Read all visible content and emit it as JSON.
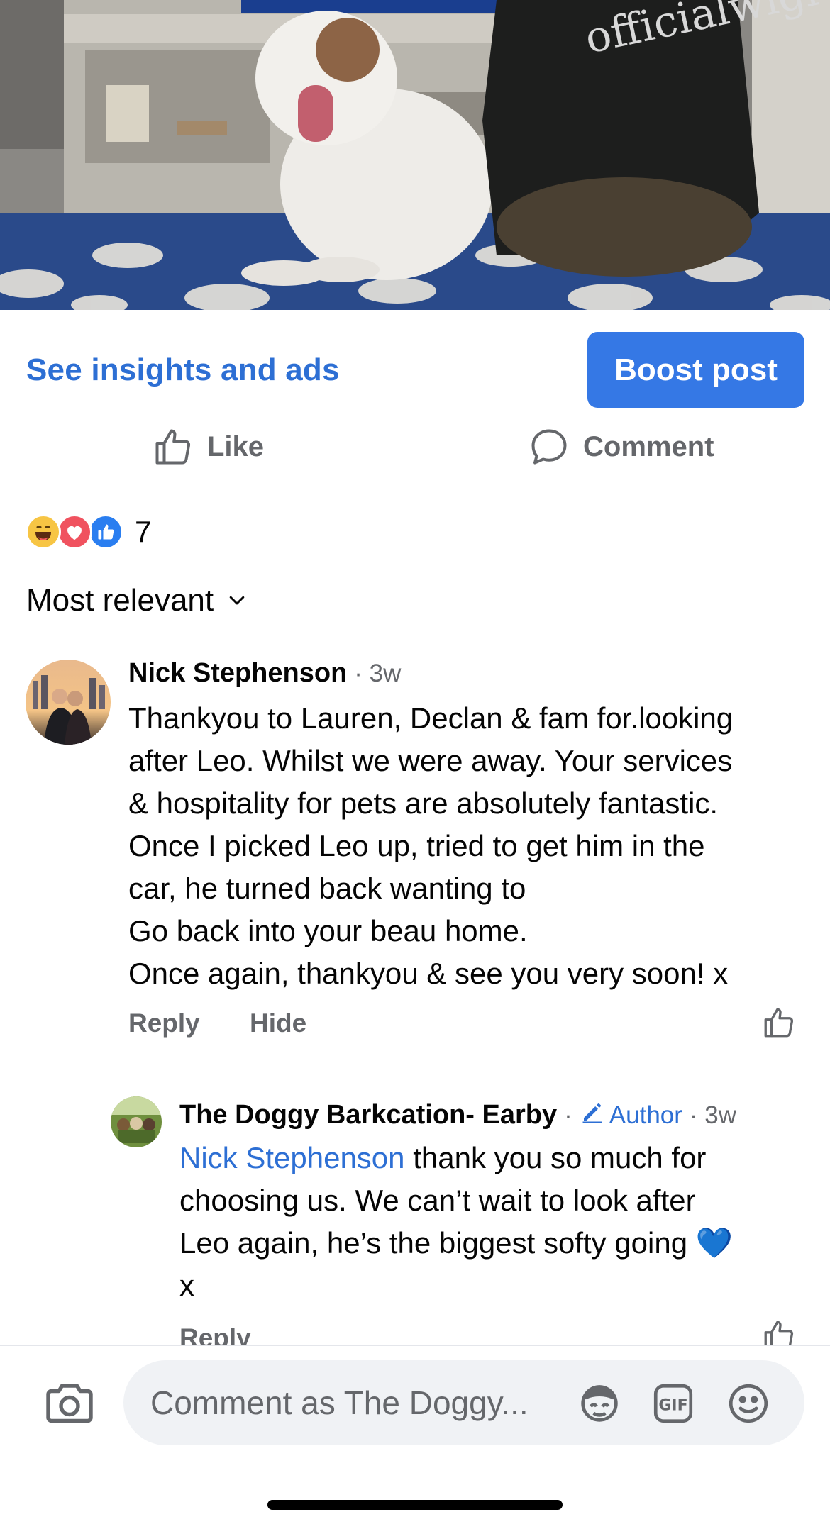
{
  "post": {
    "insights_link": "See insights and ads",
    "boost_button": "Boost post",
    "like_label": "Like",
    "comment_label": "Comment"
  },
  "reactions": {
    "icons": [
      "haha",
      "love",
      "like"
    ],
    "count": "7"
  },
  "sort": {
    "label": "Most relevant"
  },
  "comments": [
    {
      "author": "Nick Stephenson",
      "time": "· 3w",
      "text_lines": [
        "Thankyou to Lauren, Declan & fam for.looking",
        "after Leo. Whilst we were away. Your services",
        "& hospitality for pets are absolutely fantastic.",
        "Once I picked Leo up, tried to get him in the",
        "car, he turned back wanting to",
        "Go back into your beau home.",
        "Once again, thankyou & see you very soon! x"
      ],
      "reply_label": "Reply",
      "hide_label": "Hide"
    },
    {
      "author": "The Doggy Barkcation- Earby",
      "separator": "·",
      "badge": "Author",
      "time": "· 3w",
      "mention": "Nick Stephenson",
      "text_first": " thank you so much for",
      "text_lines": [
        "choosing us. We can’t wait to look after",
        "Leo again, he’s the biggest softy going 💙",
        "x"
      ],
      "reply_label": "Reply"
    }
  ],
  "composer": {
    "placeholder": "Comment as The Doggy..."
  },
  "colors": {
    "accent": "#3578e5",
    "link": "#2d6fd4",
    "secondary_text": "#65676b"
  }
}
